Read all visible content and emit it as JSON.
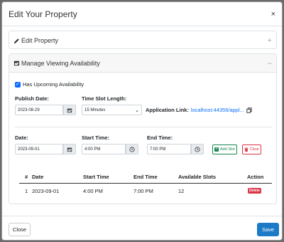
{
  "modal": {
    "title": "Edit Your Property",
    "close_glyph": "×"
  },
  "edit_panel": {
    "title": "Edit Property",
    "icon": "pencil-icon",
    "toggle": "+"
  },
  "availability_panel": {
    "title": "Manage Viewing Availability",
    "icon": "calendar-icon",
    "toggle": "–",
    "checkbox_label": "Has Upcoming Availability",
    "checkbox_checked": true
  },
  "publish": {
    "label": "Publish Date:",
    "value": "2023-08-29"
  },
  "time_slot": {
    "label": "Time Slot Length:",
    "value": "15 Minutes"
  },
  "app_link": {
    "label": "Application Link:",
    "value": "localhost:44356/appl..."
  },
  "slot_form": {
    "date_label": "Date:",
    "date_value": "2023-09-01",
    "start_label": "Start Time:",
    "start_value": "4:00 PM",
    "end_label": "End Time:",
    "end_value": "7:00 PM",
    "add_label": "Add Slot",
    "clear_label": "Clear"
  },
  "table": {
    "headers": [
      "#",
      "Date",
      "Start Time",
      "End Time",
      "Available Slots",
      "Action"
    ],
    "rows": [
      {
        "num": "1",
        "date": "2023-09-01",
        "start": "4:00 PM",
        "end": "7:00 PM",
        "slots": "12",
        "action": "Delete"
      }
    ]
  },
  "footer": {
    "close_label": "Close",
    "save_label": "Save"
  },
  "colors": {
    "primary": "#0d6efd",
    "success": "#198754",
    "danger": "#dc3545",
    "save": "#1d7ac6"
  }
}
